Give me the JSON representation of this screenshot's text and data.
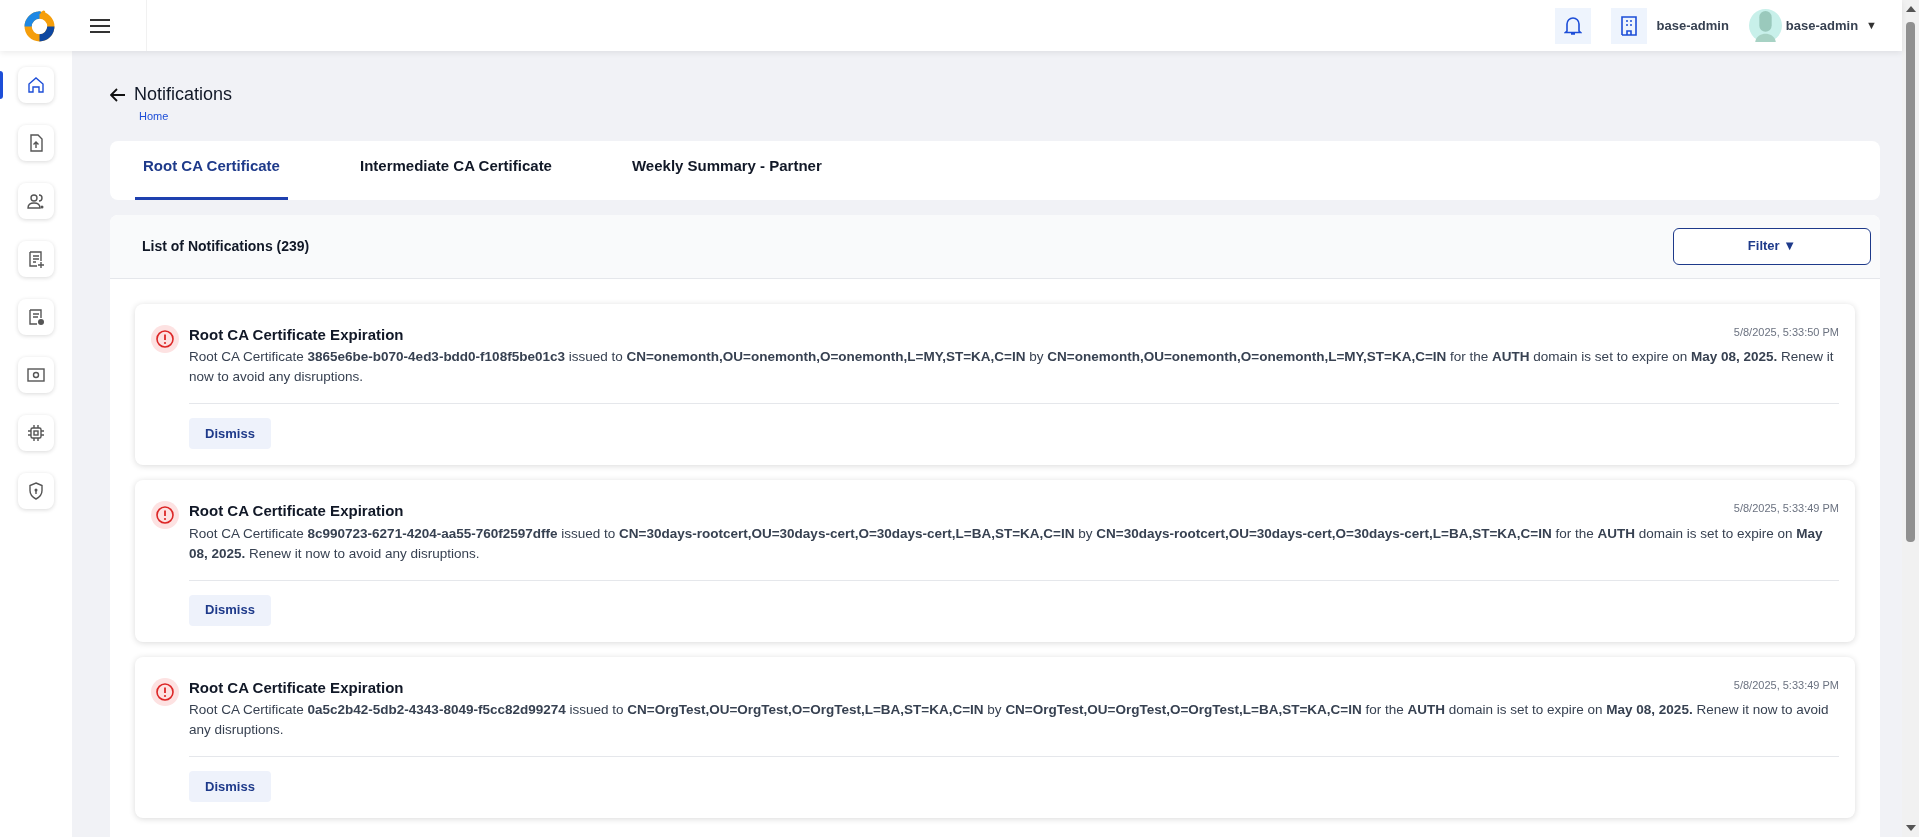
{
  "header": {
    "user_org": "base-admin",
    "user_name": "base-admin",
    "dropdown_glyph": "▼"
  },
  "sidebar": {
    "items": [
      {
        "selected": true
      },
      {
        "selected": false
      },
      {
        "selected": false
      },
      {
        "selected": false
      },
      {
        "selected": false
      },
      {
        "selected": false
      },
      {
        "selected": false
      },
      {
        "selected": false
      }
    ]
  },
  "page": {
    "title": "Notifications",
    "breadcrumb": "Home"
  },
  "tabs": [
    {
      "label": "Root CA Certificate",
      "selected": true
    },
    {
      "label": "Intermediate CA Certificate",
      "selected": false
    },
    {
      "label": "Weekly Summary - Partner",
      "selected": false
    }
  ],
  "list": {
    "title": "List of Notifications (239)",
    "filter_label": "Filter",
    "filter_glyph": "▼"
  },
  "notifications": [
    {
      "title": "Root CA Certificate Expiration",
      "time": "5/8/2025, 5:33:50 PM",
      "message": "Root CA Certificate **3865e6be-b070-4ed3-bdd0-f108f5be01c3** issued to **CN=onemonth,OU=onemonth,O=onemonth,L=MY,ST=KA,C=IN** by **CN=onemonth,OU=onemonth,O=onemonth,L=MY,ST=KA,C=IN** for the **AUTH** domain is set to expire on **May 08, 2025.** Renew it now to avoid any disruptions.",
      "action": "Dismiss"
    },
    {
      "title": "Root CA Certificate Expiration",
      "time": "5/8/2025, 5:33:49 PM",
      "message": "Root CA Certificate **8c990723-6271-4204-aa55-760f2597dffe** issued to **CN=30days-rootcert,OU=30days-cert,O=30days-cert,L=BA,ST=KA,C=IN** by **CN=30days-rootcert,OU=30days-cert,O=30days-cert,L=BA,ST=KA,C=IN** for the **AUTH** domain is set to expire on **May 08, 2025.** Renew it now to avoid any disruptions.",
      "action": "Dismiss"
    },
    {
      "title": "Root CA Certificate Expiration",
      "time": "5/8/2025, 5:33:49 PM",
      "message": "Root CA Certificate **0a5c2b42-5db2-4343-8049-f5cc82d99274** issued to **CN=OrgTest,OU=OrgTest,O=OrgTest,L=BA,ST=KA,C=IN** by **CN=OrgTest,OU=OrgTest,O=OrgTest,L=BA,ST=KA,C=IN** for the **AUTH** domain is set to expire on **May 08, 2025.** Renew it now to avoid any disruptions.",
      "action": "Dismiss"
    }
  ]
}
